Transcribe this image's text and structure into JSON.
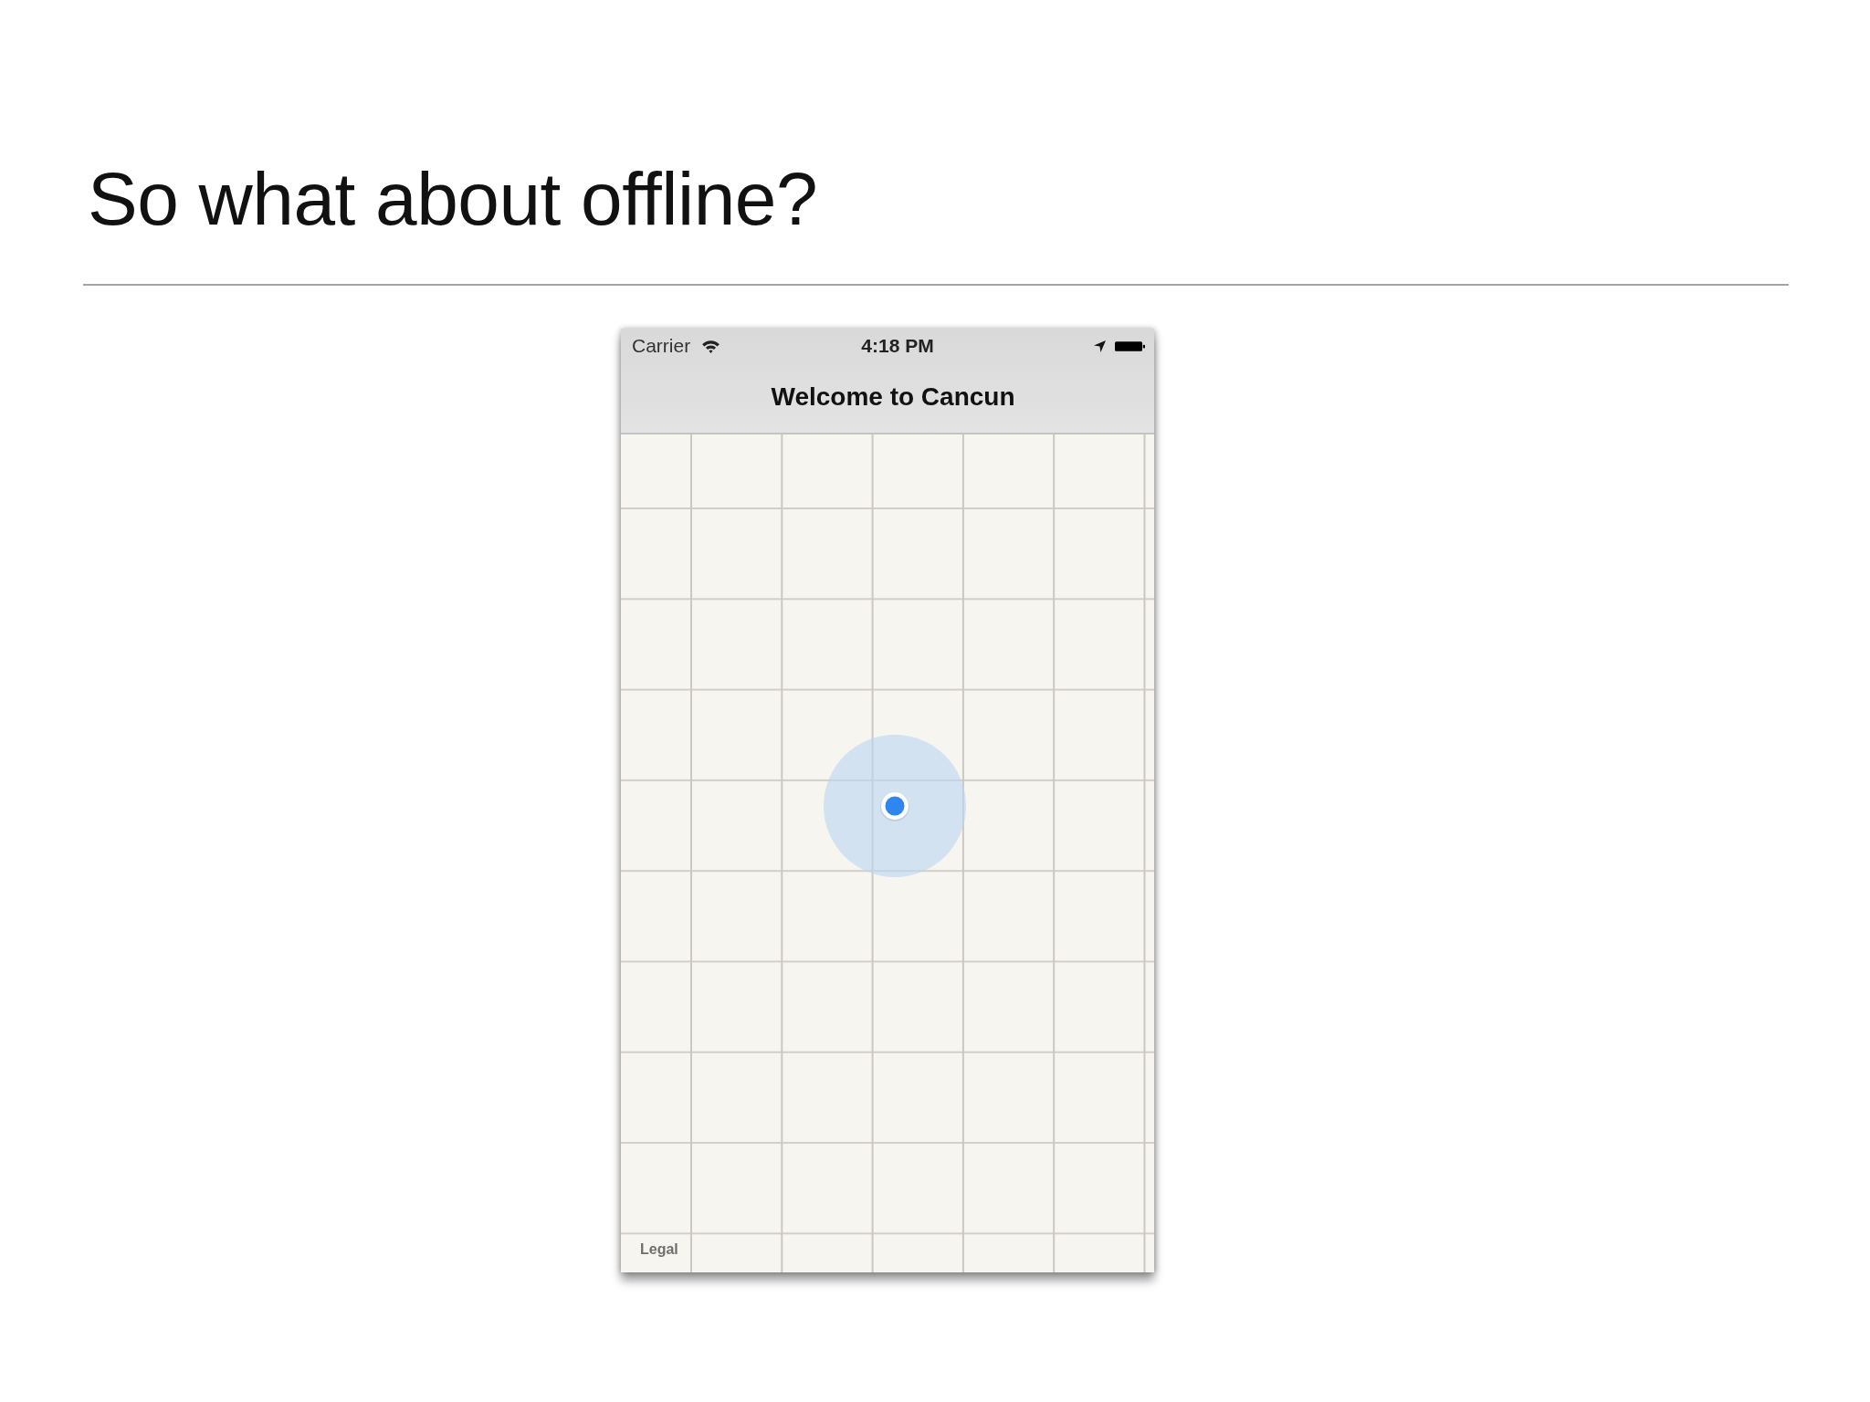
{
  "slide": {
    "title": "So what about offline?"
  },
  "phone": {
    "status_bar": {
      "carrier": "Carrier",
      "time": "4:18 PM"
    },
    "nav_bar": {
      "title": "Welcome to Cancun"
    },
    "map": {
      "legal": "Legal"
    }
  }
}
